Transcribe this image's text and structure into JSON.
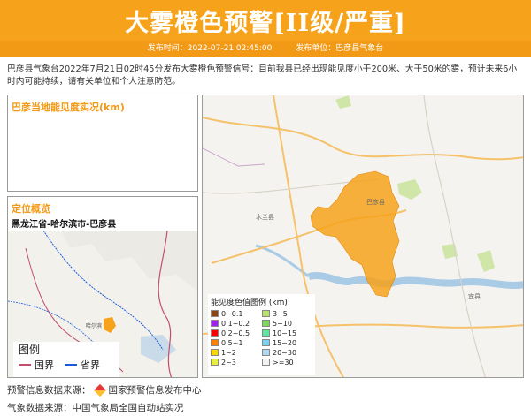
{
  "header": {
    "title": "大雾橙色预警[II级/严重]",
    "publish_time": "发布时间：2022-07-21 02:45:00",
    "publisher": "发布单位：巴彦县气象台",
    "color": "#f6a21a"
  },
  "description": "巴彦县气象台2022年7月21日02时45分发布大雾橙色预警信号：目前我县已经出现能见度小于200米、大于50米的雾，预计未来6小时内可能持续，请有关单位和个人注意防范。",
  "visibility_panel": {
    "title": "巴彦当地能见度实况(km)"
  },
  "location_panel": {
    "title": "定位概览",
    "region": "黑龙江省-哈尔滨市-巴彦县",
    "legend": {
      "title": "图例",
      "items": [
        {
          "label": "国界",
          "color": "#c0506c"
        },
        {
          "label": "省界",
          "color": "#1b5ad6"
        }
      ]
    }
  },
  "map": {
    "legend": {
      "title": "能见度色值图例 (km)",
      "items": [
        {
          "label": "0~0.1",
          "color": "#8b4513"
        },
        {
          "label": "3~5",
          "color": "#b7e36b"
        },
        {
          "label": "0.1~0.2",
          "color": "#a020f0"
        },
        {
          "label": "5~10",
          "color": "#7dd85a"
        },
        {
          "label": "0.2~0.5",
          "color": "#ff0000"
        },
        {
          "label": "10~15",
          "color": "#5ce6a0"
        },
        {
          "label": "0.5~1",
          "color": "#ff7f00"
        },
        {
          "label": "15~20",
          "color": "#7ad0f0"
        },
        {
          "label": "1~2",
          "color": "#ffd700"
        },
        {
          "label": "20~30",
          "color": "#b0d8f0"
        },
        {
          "label": "2~3",
          "color": "#e6f03c"
        },
        {
          "label": ">=30",
          "color": "#f2f2f2"
        }
      ]
    }
  },
  "footer": {
    "source_label": "预警信息数据来源：",
    "source_value": "国家预警信息发布中心",
    "weather_source": "气象数据来源：中国气象局全国自动站实况"
  }
}
